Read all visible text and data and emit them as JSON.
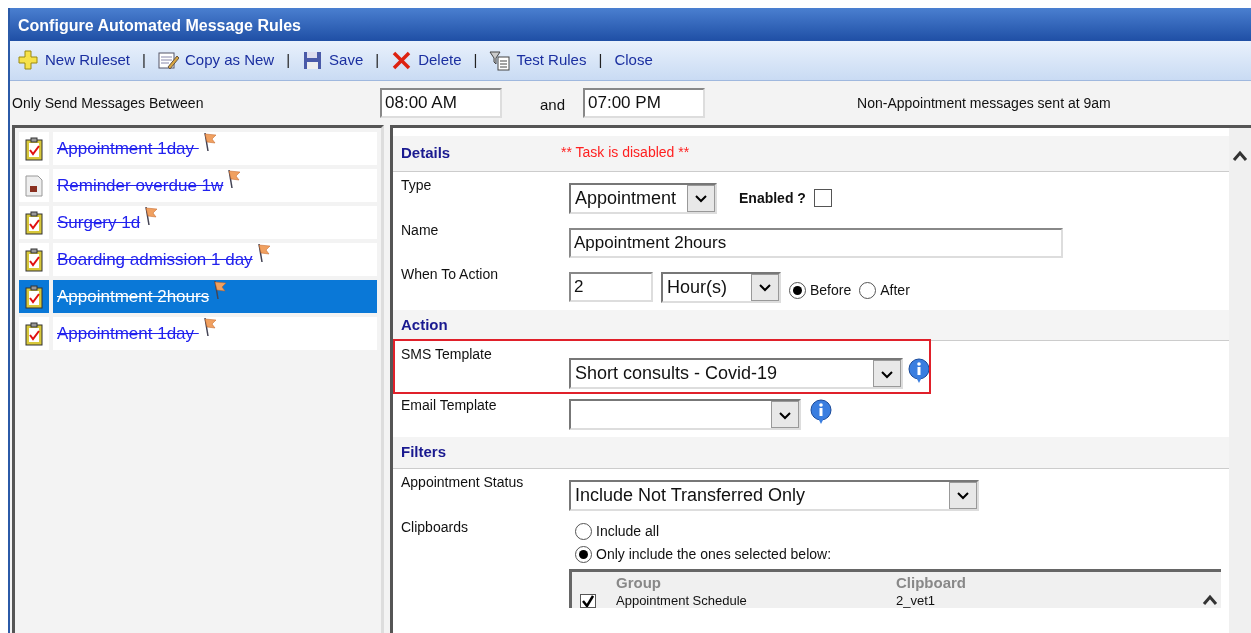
{
  "window": {
    "title": "Configure Automated Message Rules"
  },
  "toolbar": [
    {
      "kind": "new",
      "label": "New Ruleset",
      "separator": "|"
    },
    {
      "kind": "copy",
      "label": "Copy as New",
      "separator": "|"
    },
    {
      "kind": "save",
      "label": "Save",
      "separator": "|"
    },
    {
      "kind": "delete",
      "label": "Delete",
      "separator": "|"
    },
    {
      "kind": "test",
      "label": "Test Rules",
      "separator": "|"
    },
    {
      "kind": "close",
      "label": "Close"
    }
  ],
  "send_window": {
    "label": "Only Send Messages Between",
    "from": "08:00 AM",
    "and": "and",
    "to": "07:00 PM",
    "note": "Non-Appointment messages sent at 9am"
  },
  "rulesets": [
    {
      "kind": "clipboard",
      "name": "Appointment 1day ",
      "disabled": true,
      "selected": false
    },
    {
      "kind": "document",
      "name": "Reminder overdue 1w",
      "disabled": true,
      "selected": false
    },
    {
      "kind": "clipboard",
      "name": "Surgery 1d",
      "disabled": true,
      "selected": false
    },
    {
      "kind": "clipboard",
      "name": "Boarding admission 1 day",
      "disabled": true,
      "selected": false
    },
    {
      "kind": "clipboard",
      "name": "Appointment 2hours",
      "disabled": true,
      "selected": true
    },
    {
      "kind": "clipboard",
      "name": "Appointment 1day ",
      "disabled": true,
      "selected": false
    }
  ],
  "details": {
    "heading": "Details",
    "warning": "** Task is disabled **",
    "type_label": "Type",
    "type_value": "Appointment",
    "enabled_label": "Enabled ?",
    "enabled": false,
    "name_label": "Name",
    "name_value": "Appointment 2hours",
    "when_label": "When To Action",
    "when_amount": "2",
    "when_unit": "Hour(s)",
    "timing": [
      {
        "label": "Before",
        "selected": true
      },
      {
        "label": "After",
        "selected": false
      }
    ]
  },
  "action": {
    "heading": "Action",
    "sms_label": "SMS Template",
    "sms_value": "Short consults - Covid-19",
    "highlighted": true,
    "email_label": "Email Template"
  },
  "filters": {
    "heading": "Filters",
    "status_label": "Appointment Status",
    "status_value": "Include Not Transferred Only",
    "clipboards_label": "Clipboards",
    "clipboard_modes": [
      {
        "label": "Include all",
        "selected": false
      },
      {
        "label": "Only include the ones selected below:",
        "selected": true
      }
    ],
    "table": {
      "columns": [
        "Group",
        "Clipboard"
      ],
      "rows": [
        {
          "checked": true,
          "cells": [
            "Appointment Schedule",
            "2_vet1"
          ]
        }
      ]
    }
  }
}
